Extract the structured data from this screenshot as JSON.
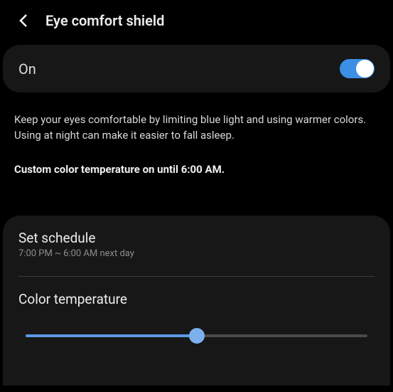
{
  "header": {
    "title": "Eye comfort shield"
  },
  "toggle": {
    "label": "On",
    "state": "on"
  },
  "info": {
    "description": "Keep your eyes comfortable by limiting blue light and using warmer colors. Using at night can make it easier to fall asleep.",
    "status": "Custom color temperature on until 6:00 AM."
  },
  "schedule": {
    "title": "Set schedule",
    "range": "7:00 PM ~ 6:00 AM next day"
  },
  "colorTemp": {
    "title": "Color temperature",
    "value": 50
  }
}
